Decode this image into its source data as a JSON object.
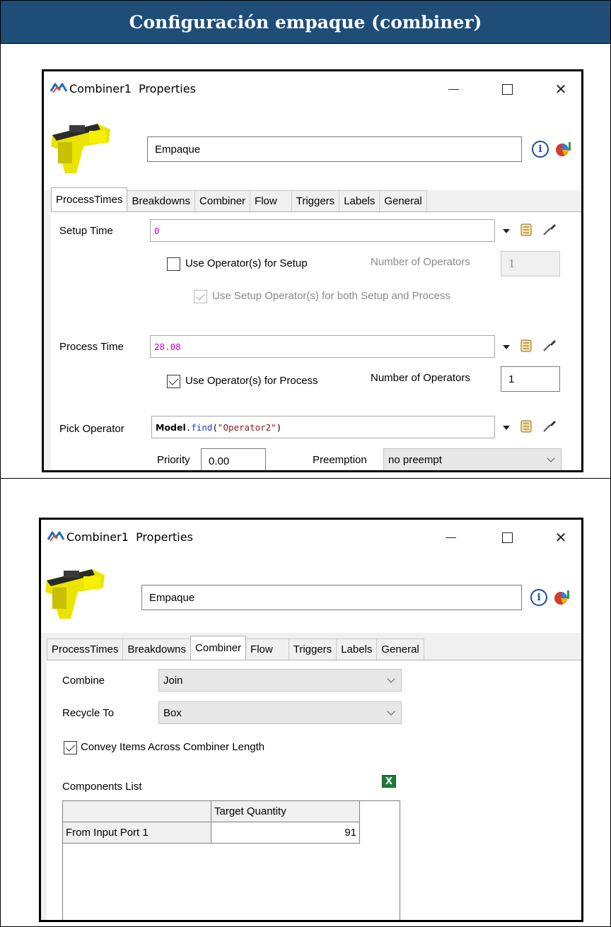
{
  "doc": {
    "heading": "Configuración empaque (combiner)"
  },
  "window1": {
    "title": "Combiner1  Properties",
    "name_value": "Empaque",
    "tabs": [
      "ProcessTimes",
      "Breakdowns",
      "Combiner",
      "Flow",
      "Triggers",
      "Labels",
      "General"
    ],
    "active_tab": "ProcessTimes",
    "setup_time_label": "Setup Time",
    "setup_time_value": "0",
    "use_operators_setup_label": "Use Operator(s) for Setup",
    "use_operators_setup_checked": false,
    "setup_num_operators_label": "Number of Operators",
    "setup_num_operators_value": "1",
    "use_setup_both_label": "Use Setup Operator(s) for both Setup and Process",
    "use_setup_both_checked": true,
    "process_time_label": "Process Time",
    "process_time_value": "28.08",
    "use_operators_process_label": "Use Operator(s) for Process",
    "use_operators_process_checked": true,
    "process_num_operators_label": "Number of Operators",
    "process_num_operators_value": "1",
    "pick_operator_label": "Pick Operator",
    "pick_operator_code": {
      "keyword": "Model",
      "dot": ".",
      "fn": "find",
      "open": "(",
      "str": "\"Operator2\"",
      "close": ")"
    },
    "priority_label": "Priority",
    "priority_value": "0.00",
    "preemption_label": "Preemption",
    "preemption_value": "no preempt"
  },
  "window2": {
    "title": "Combiner1  Properties",
    "name_value": "Empaque",
    "tabs": [
      "ProcessTimes",
      "Breakdowns",
      "Combiner",
      "Flow",
      "Triggers",
      "Labels",
      "General"
    ],
    "active_tab": "Combiner",
    "combine_label": "Combine",
    "combine_value": "Join",
    "recycle_label": "Recycle To",
    "recycle_value": "Box",
    "convey_label": "Convey Items Across Combiner Length",
    "convey_checked": true,
    "components_label": "Components List",
    "table": {
      "columns": [
        "",
        "Target Quantity"
      ],
      "rows": [
        {
          "label": "From Input Port 1",
          "quantity": "91"
        }
      ]
    }
  },
  "colors": {
    "header_bg": "#1e4d78",
    "code_magenta": "#d000d0",
    "code_blue": "#1a3fd0",
    "code_string": "#8a1515"
  },
  "icons": [
    "flexsim-logo-icon",
    "minimize-icon",
    "maximize-icon",
    "close-icon",
    "info-icon",
    "statistics-icon",
    "dropdown-arrow-icon",
    "code-edit-icon",
    "sampler-icon",
    "excel-export-icon",
    "chevron-down-icon"
  ]
}
